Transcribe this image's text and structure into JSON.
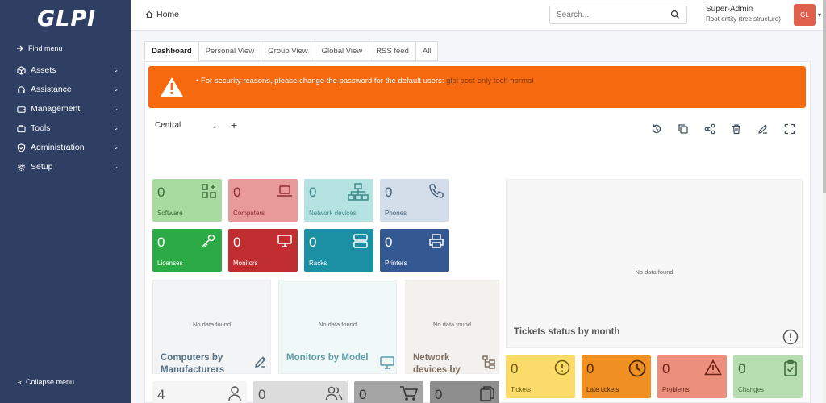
{
  "app": {
    "logo": "GLPI"
  },
  "sidebar": {
    "find_menu": "Find menu",
    "items": [
      {
        "label": "Assets",
        "icon": "box-icon"
      },
      {
        "label": "Assistance",
        "icon": "headset-icon"
      },
      {
        "label": "Management",
        "icon": "wallet-icon"
      },
      {
        "label": "Tools",
        "icon": "briefcase-icon"
      },
      {
        "label": "Administration",
        "icon": "shield-icon"
      },
      {
        "label": "Setup",
        "icon": "gear-icon"
      }
    ],
    "collapse": "Collapse menu"
  },
  "topbar": {
    "breadcrumb": "Home",
    "search_placeholder": "Search...",
    "user_name": "Super-Admin",
    "entity": "Root entity (tree structure)",
    "avatar_initials": "GL"
  },
  "tabs": [
    "Dashboard",
    "Personal View",
    "Group View",
    "Global View",
    "RSS feed",
    "All"
  ],
  "alert": {
    "message": "For security reasons, please change the password for the default users:",
    "users": "glpi post-only tech normal"
  },
  "dashboard": {
    "selected": "Central"
  },
  "cards": [
    {
      "value": "0",
      "label": "Software",
      "bg": "#a8dba0",
      "fg": "#3f6d3a",
      "icon": "apps-plus-icon"
    },
    {
      "value": "0",
      "label": "Computers",
      "bg": "#e89999",
      "fg": "#8c2f2f",
      "icon": "laptop-icon"
    },
    {
      "value": "0",
      "label": "Network devices",
      "bg": "#b5e3e1",
      "fg": "#3e8a8a",
      "icon": "network-icon"
    },
    {
      "value": "0",
      "label": "Phones",
      "bg": "#d3deea",
      "fg": "#4a6078",
      "icon": "phone-icon"
    },
    {
      "value": "0",
      "label": "Licenses",
      "bg": "#2caa46",
      "fg": "#ffffff",
      "icon": "key-icon"
    },
    {
      "value": "0",
      "label": "Monitors",
      "bg": "#bf2d31",
      "fg": "#ffffff",
      "icon": "monitor-icon"
    },
    {
      "value": "0",
      "label": "Racks",
      "bg": "#1b8fa3",
      "fg": "#ffffff",
      "icon": "server-icon"
    },
    {
      "value": "0",
      "label": "Printers",
      "bg": "#345892",
      "fg": "#ffffff",
      "icon": "printer-icon"
    },
    {
      "value": "0",
      "label": "Tickets",
      "bg": "#fbdc6b",
      "fg": "#6e5a10",
      "icon": "alert-circle-icon"
    },
    {
      "value": "0",
      "label": "Late tickets",
      "bg": "#f08f22",
      "fg": "#4a2a05",
      "icon": "clock-icon"
    },
    {
      "value": "0",
      "label": "Problems",
      "bg": "#ec8f7c",
      "fg": "#6a2418",
      "icon": "warning-icon"
    },
    {
      "value": "0",
      "label": "Changes",
      "bg": "#b6deb0",
      "fg": "#3f6d3a",
      "icon": "clipboard-check-icon"
    }
  ],
  "widgets": [
    {
      "title": "Computers by Manufacturers",
      "empty": "No data found",
      "bg": "#f2f4f6",
      "fg": "#556f80",
      "icon": "edit-icon"
    },
    {
      "title": "Monitors by Model",
      "empty": "No data found",
      "bg": "#f1f8f8",
      "fg": "#5e9ca8",
      "icon": "monitor-icon"
    },
    {
      "title": "Network devices by",
      "empty": "No data found",
      "bg": "#f3f1ee",
      "fg": "#7d6e60",
      "icon": "hierarchy-icon"
    },
    {
      "title": "Tickets status by month",
      "empty": "No data found",
      "bg": "#f7f7f7",
      "fg": "#555555",
      "icon": "alert-circle-icon"
    }
  ],
  "bottom": [
    {
      "value": "4",
      "bg": "#f5f5f5",
      "fg": "#555",
      "icon": "user-icon"
    },
    {
      "value": "0",
      "bg": "#dcdcdc",
      "fg": "#555",
      "icon": "users-icon"
    },
    {
      "value": "0",
      "bg": "#a5a5a5",
      "fg": "#333",
      "icon": "cart-icon"
    },
    {
      "value": "0",
      "bg": "#8e8e8e",
      "fg": "#333",
      "icon": "files-icon"
    }
  ]
}
